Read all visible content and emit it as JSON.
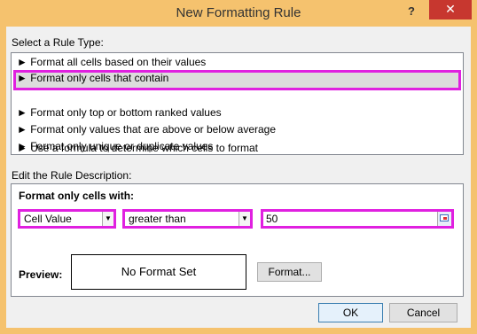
{
  "window": {
    "title": "New Formatting Rule",
    "help_label": "?",
    "close_label": "✕"
  },
  "rule_type": {
    "label": "Select a Rule Type:",
    "items": [
      {
        "label": "► Format all cells based on their values"
      },
      {
        "label": "► Format only cells that contain"
      },
      {
        "label": "► Format only top or bottom ranked values"
      },
      {
        "label": "► Format only values that are above or below average"
      },
      {
        "label": "► Format only unique or duplicate values"
      },
      {
        "label": "► Use a formula to determine which cells to format"
      }
    ],
    "selected_index": 1
  },
  "description": {
    "label": "Edit the Rule Description:",
    "heading": "Format only cells with:",
    "condition_type": "Cell Value",
    "operator": "greater than",
    "value": "50",
    "preview_label": "Preview:",
    "preview_text": "No Format Set",
    "format_button": "Format..."
  },
  "buttons": {
    "ok": "OK",
    "cancel": "Cancel"
  },
  "colors": {
    "highlight": "#e020e0",
    "titlebar": "#f5c26e",
    "close": "#c7372f"
  }
}
